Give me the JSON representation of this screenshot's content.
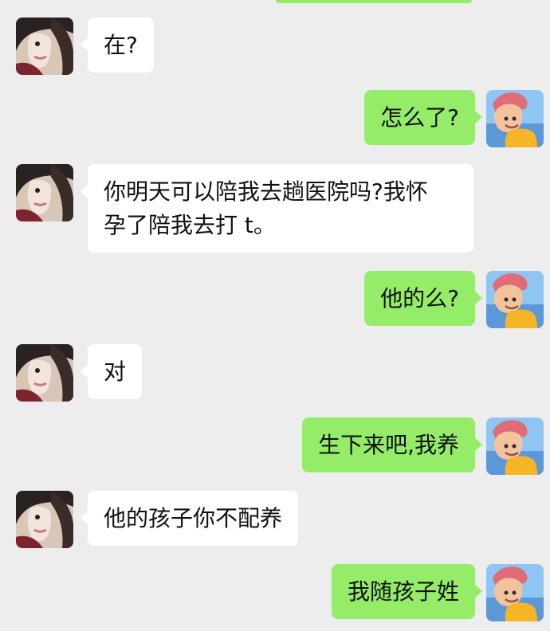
{
  "conversation": {
    "messages": [
      {
        "sender": "contact",
        "text": "在?"
      },
      {
        "sender": "self",
        "text": "怎么了?"
      },
      {
        "sender": "contact",
        "text": "你明天可以陪我去趟医院吗?我怀\n孕了陪我去打 t。"
      },
      {
        "sender": "self",
        "text": "他的么?"
      },
      {
        "sender": "contact",
        "text": "对"
      },
      {
        "sender": "self",
        "text": "生下来吧,我养"
      },
      {
        "sender": "contact",
        "text": "他的孩子你不配养"
      },
      {
        "sender": "self",
        "text": "我随孩子姓"
      }
    ]
  },
  "style": {
    "chat_background": "#ededed",
    "incoming_bubble": "#ffffff",
    "outgoing_bubble": "#95ec69",
    "text_color": "#111111"
  }
}
